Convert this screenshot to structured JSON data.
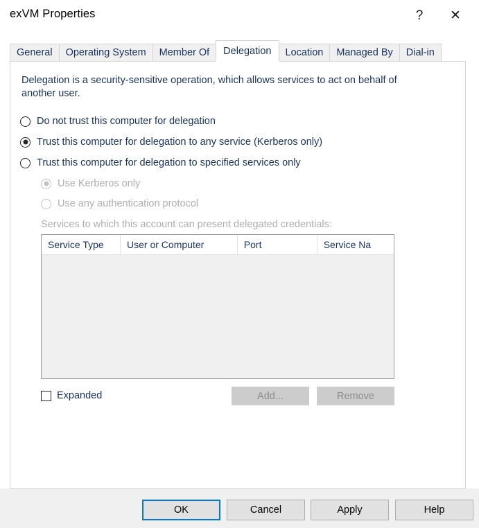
{
  "window": {
    "title": "exVM Properties",
    "help_glyph": "?",
    "close_glyph": "✕"
  },
  "tabs": [
    {
      "label": "General",
      "active": false
    },
    {
      "label": "Operating System",
      "active": false
    },
    {
      "label": "Member Of",
      "active": false
    },
    {
      "label": "Delegation",
      "active": true
    },
    {
      "label": "Location",
      "active": false
    },
    {
      "label": "Managed By",
      "active": false
    },
    {
      "label": "Dial-in",
      "active": false
    }
  ],
  "delegation": {
    "description": "Delegation is a security-sensitive operation, which allows services to act on behalf of another user.",
    "options": [
      {
        "label": "Do not trust this computer for delegation",
        "selected": false,
        "disabled": false
      },
      {
        "label": "Trust this computer for delegation to any service (Kerberos only)",
        "selected": true,
        "disabled": false
      },
      {
        "label": "Trust this computer for delegation to specified services only",
        "selected": false,
        "disabled": false
      }
    ],
    "sub_options": [
      {
        "label": "Use Kerberos only",
        "selected": true,
        "disabled": true
      },
      {
        "label": "Use any authentication protocol",
        "selected": false,
        "disabled": true
      }
    ],
    "services_label": "Services to which this account can present delegated credentials:",
    "table": {
      "columns": [
        "Service Type",
        "User or Computer",
        "Port",
        "Service Na"
      ],
      "rows": []
    },
    "expanded": {
      "label": "Expanded",
      "checked": false
    },
    "add_button": {
      "label": "Add...",
      "disabled": true
    },
    "remove_button": {
      "label": "Remove",
      "disabled": true
    }
  },
  "footer": {
    "ok": "OK",
    "cancel": "Cancel",
    "apply": "Apply",
    "help": "Help"
  },
  "colors": {
    "accent": "#0078d7",
    "label_text": "#17325e",
    "disabled_text": "#aeaeae",
    "panel_bg": "#ffffff",
    "footer_bg": "#f0f0f0",
    "table_body_bg": "#f0f0f0"
  }
}
